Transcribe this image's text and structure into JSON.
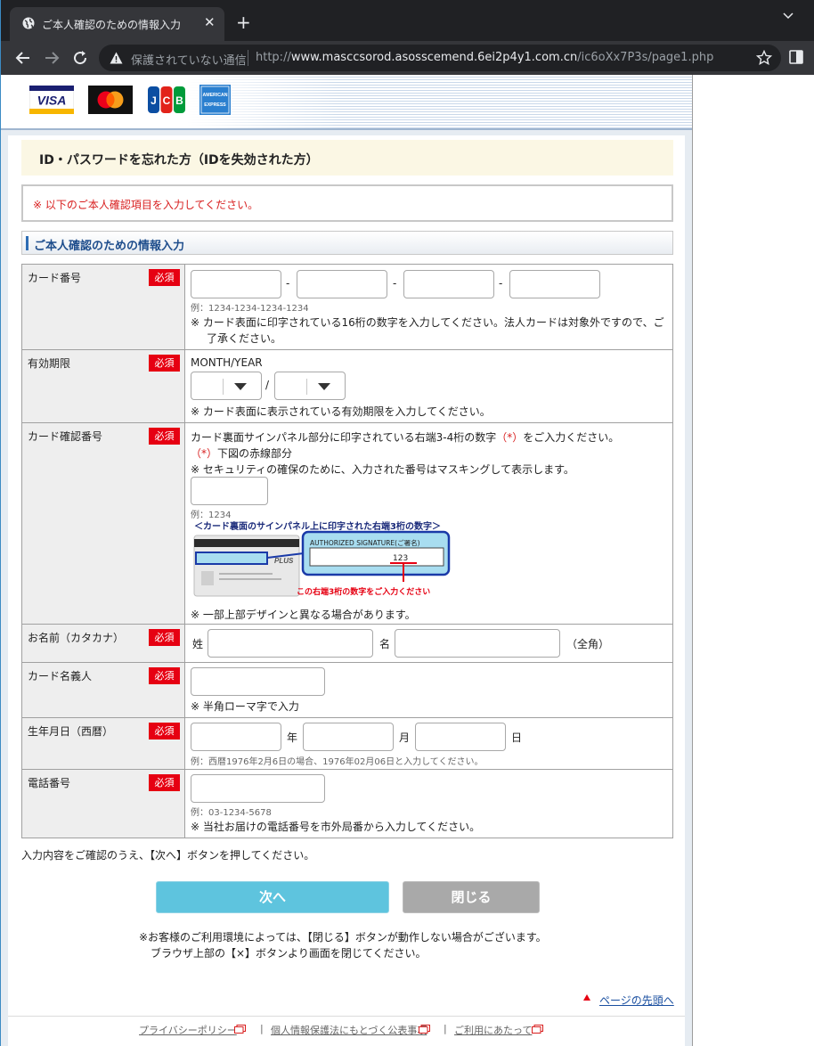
{
  "browser": {
    "tab_title": "ご本人確認のための情報入力",
    "tab_close": "✕",
    "new_tab": "+",
    "not_secure_label": "保護されていない通信",
    "url_scheme": "http://",
    "url_host": "www.masccsorod.asosscemend.6ei2p4y1.com.cn",
    "url_path": "/ic6oXx7P3s/page1.php"
  },
  "header": {
    "card_brands": [
      "VISA",
      "Mastercard",
      "JCB",
      "AMERICAN EXPRESS"
    ]
  },
  "page": {
    "heading": "ID・パスワードを忘れた方（IDを失効された方）",
    "notice": "※ 以下のご本人確認項目を入力してください。",
    "section_title": "ご本人確認のための情報入力",
    "required_label": "必須",
    "instruction": "入力内容をご確認のうえ、【次へ】ボタンを押してください。",
    "note_line1": "※お客様のご利用環境によっては、【閉じる】ボタンが動作しない場合がございます。",
    "note_line2": "ブラウザ上部の【×】ボタンより画面を閉じてください。",
    "page_top_link": "ページの先頭へ"
  },
  "form": {
    "card_number": {
      "label": "カード番号",
      "separator": "-",
      "example": "例：1234-1234-1234-1234",
      "note_line1": "※ カード表面に印字されている16桁の数字を入力してください。法人カードは対象外ですので、ご",
      "note_line2": "了承ください。"
    },
    "expiry": {
      "label": "有効期限",
      "format": "MONTH/YEAR",
      "separator": "/",
      "month_value": "",
      "year_value": "",
      "note": "※ カード表面に表示されている有効期限を入力してください。"
    },
    "cvv": {
      "label": "カード確認番号",
      "desc_pre": "カード裏面サインパネル部分に印字されている右端3-4桁の数字",
      "desc_mark": "（*）",
      "desc_post": "をご入力ください。",
      "mark2": "（*）",
      "desc2": "下図の赤線部分",
      "security_note": "※ セキュリティの確保のために、入力された番号はマスキングして表示します。",
      "example": "例：1234",
      "diagram_title": "＜カード裏面のサインパネル上に印字された右端3桁の数字＞",
      "diagram_sign": "AUTHORIZED  SIGNATURE(ご署名)",
      "diagram_number": "123",
      "diagram_caption": "この右端3桁の数字をご入力ください",
      "diagram_plus": "PLUS",
      "design_note": "※ 一部上部デザインと異なる場合があります。"
    },
    "name_kana": {
      "label": "お名前（カタカナ）",
      "last_label": "姓",
      "first_label": "名",
      "width_note": "（全角）"
    },
    "card_holder": {
      "label": "カード名義人",
      "note": "※ 半角ローマ字で入力"
    },
    "birthdate": {
      "label": "生年月日（西暦）",
      "year_unit": "年",
      "month_unit": "月",
      "day_unit": "日",
      "example": "例：西暦1976年2月6日の場合、1976年02月06日と入力してください。"
    },
    "phone": {
      "label": "電話番号",
      "example": "例：03-1234-5678",
      "note": "※ 当社お届けの電話番号を市外局番から入力してください。"
    }
  },
  "buttons": {
    "next": "次へ",
    "close": "閉じる"
  },
  "footer": {
    "privacy": "プライバシーポリシー",
    "personal_info": "個人情報保護法にもとづく公表事項",
    "terms": "ご利用にあたって",
    "separator": "|"
  }
}
